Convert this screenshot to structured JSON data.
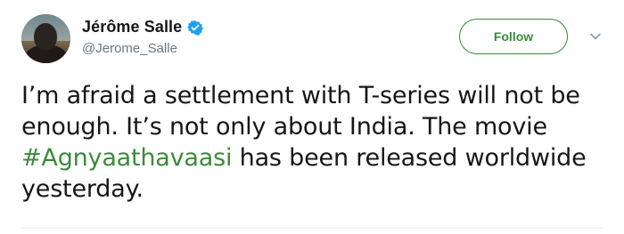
{
  "author": {
    "display_name": "Jérôme Salle",
    "handle": "@Jerome_Salle",
    "verified": true
  },
  "follow_button": {
    "label": "Follow"
  },
  "tweet": {
    "text_part1": "I’m afraid a settlement with T-series will not be enough. It’s not only about India. The movie ",
    "hashtag": "#Agnyaathavaasi",
    "text_part2": " has been released worldwide yesterday."
  },
  "colors": {
    "accent": "#3c8a3c",
    "verified": "#1da1f2",
    "handle": "#657786",
    "text": "#14171a"
  },
  "icons": {
    "verified": "verified-badge-icon",
    "menu": "chevron-down-icon"
  }
}
